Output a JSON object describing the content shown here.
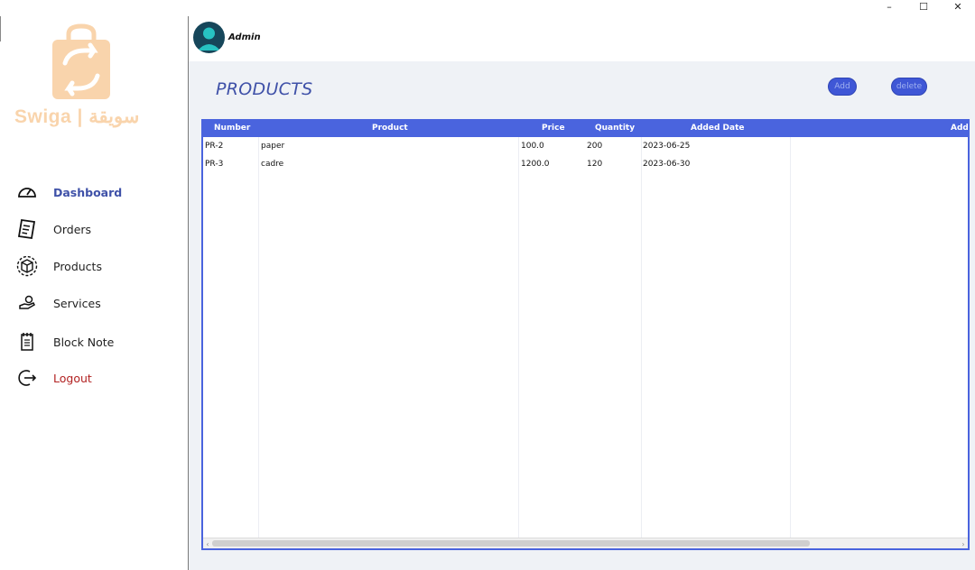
{
  "window": {
    "minimize_label": "–",
    "maximize_label": "☐",
    "close_label": "✕"
  },
  "brand": {
    "logo_text": "Swiga | سويقة",
    "logo_color": "#f9d4ac"
  },
  "sidebar": {
    "items": [
      {
        "label": "Dashboard",
        "icon": "gauge-icon",
        "active": true
      },
      {
        "label": "Orders",
        "icon": "receipt-icon"
      },
      {
        "label": "Products",
        "icon": "box-icon"
      },
      {
        "label": "Services",
        "icon": "hand-coin-icon"
      },
      {
        "label": "Block Note",
        "icon": "notepad-icon"
      },
      {
        "label": "Logout",
        "icon": "logout-icon"
      }
    ]
  },
  "header": {
    "user_label": "Admin"
  },
  "main": {
    "title": "PRODUCTS",
    "add_label": "Add",
    "delete_label": "delete"
  },
  "table": {
    "columns": [
      "Number",
      "Product",
      "Price",
      "Quantity",
      "Added Date",
      "Add"
    ],
    "rows": [
      {
        "number": "PR-2",
        "product": "paper",
        "price": "100.0",
        "quantity": "200",
        "added_date": "2023-06-25"
      },
      {
        "number": "PR-3",
        "product": "cadre",
        "price": "1200.0",
        "quantity": "120",
        "added_date": "2023-06-30"
      }
    ]
  },
  "colors": {
    "accent": "#3f51a8",
    "table_header": "#4a64de",
    "logout": "#b22222",
    "main_bg": "#eff2f6"
  }
}
